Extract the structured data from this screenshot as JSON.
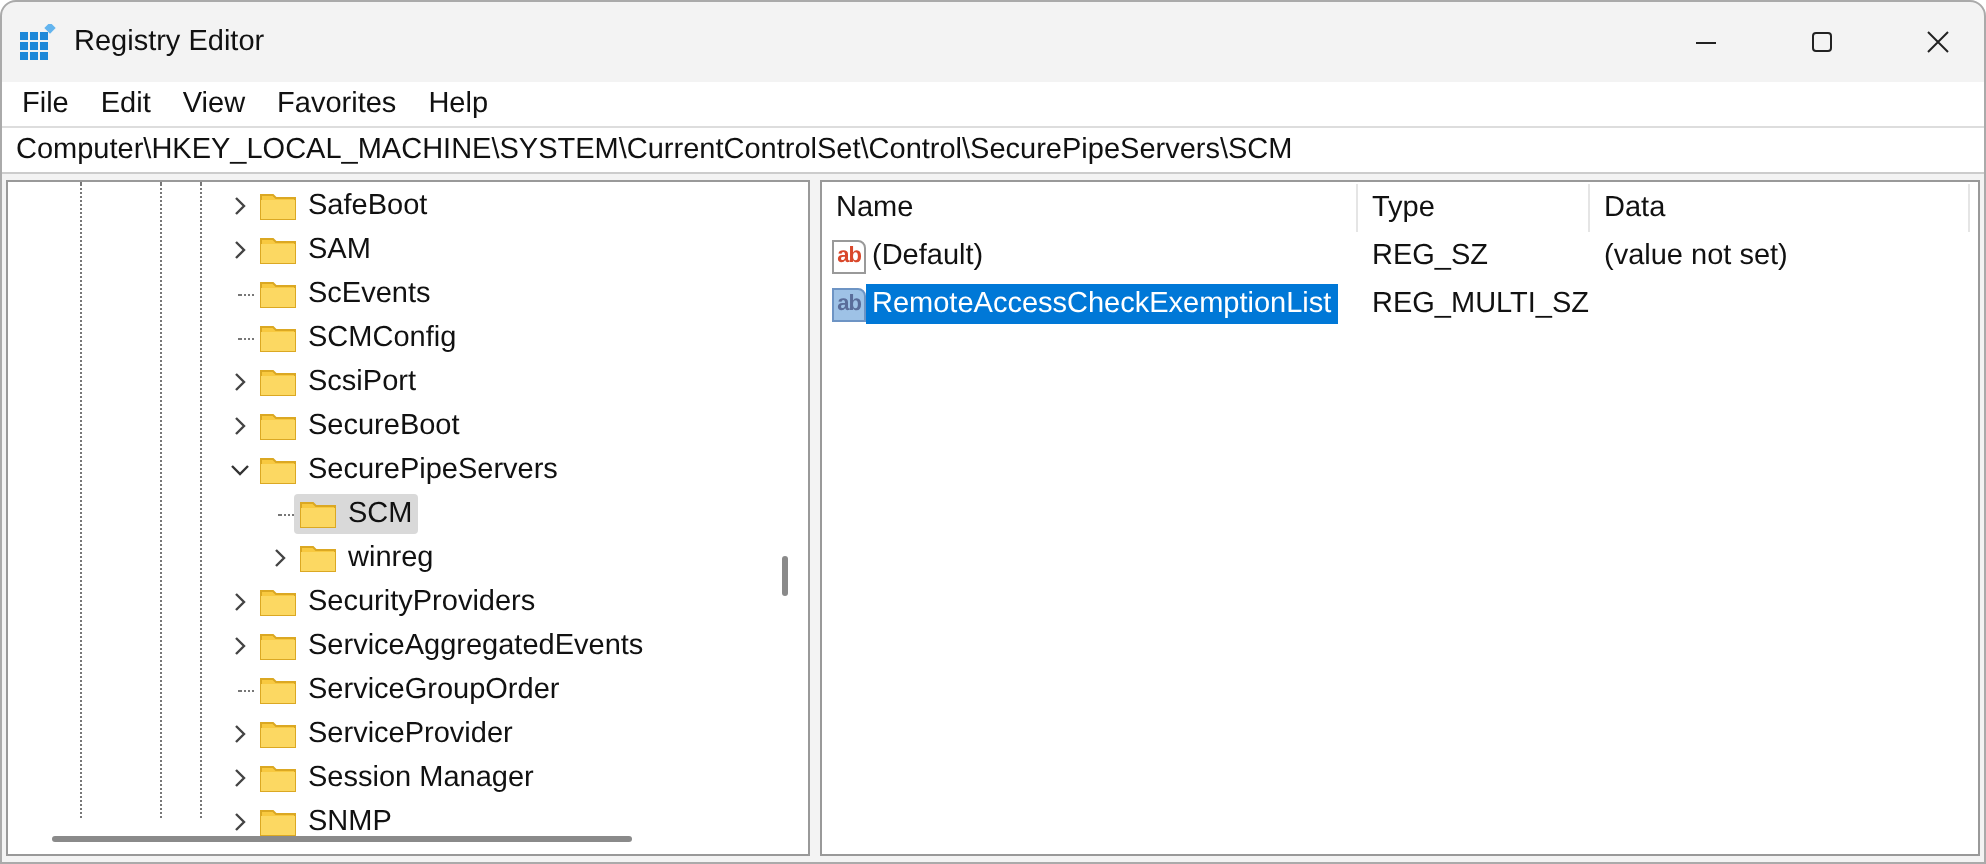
{
  "window": {
    "title": "Registry Editor"
  },
  "menu": [
    {
      "label": "File"
    },
    {
      "label": "Edit"
    },
    {
      "label": "View"
    },
    {
      "label": "Favorites"
    },
    {
      "label": "Help"
    }
  ],
  "address": {
    "value": "Computer\\HKEY_LOCAL_MACHINE\\SYSTEM\\CurrentControlSet\\Control\\SecurePipeServers\\SCM"
  },
  "tree": {
    "items": [
      {
        "label": "SafeBoot",
        "kind": "branch",
        "expanded": false,
        "selected": false
      },
      {
        "label": "SAM",
        "kind": "branch",
        "expanded": false,
        "selected": false
      },
      {
        "label": "ScEvents",
        "kind": "leaf",
        "selected": false
      },
      {
        "label": "SCMConfig",
        "kind": "leaf",
        "selected": false
      },
      {
        "label": "ScsiPort",
        "kind": "branch",
        "expanded": false,
        "selected": false
      },
      {
        "label": "SecureBoot",
        "kind": "branch",
        "expanded": false,
        "selected": false
      },
      {
        "label": "SecurePipeServers",
        "kind": "branch",
        "expanded": true,
        "selected": false,
        "children": [
          {
            "label": "SCM",
            "kind": "leaf",
            "selected": true
          },
          {
            "label": "winreg",
            "kind": "branch",
            "expanded": false,
            "selected": false
          }
        ]
      },
      {
        "label": "SecurityProviders",
        "kind": "branch",
        "expanded": false,
        "selected": false
      },
      {
        "label": "ServiceAggregatedEvents",
        "kind": "branch",
        "expanded": false,
        "selected": false
      },
      {
        "label": "ServiceGroupOrder",
        "kind": "leaf",
        "selected": false
      },
      {
        "label": "ServiceProvider",
        "kind": "branch",
        "expanded": false,
        "selected": false
      },
      {
        "label": "Session Manager",
        "kind": "branch",
        "expanded": false,
        "selected": false
      },
      {
        "label": "SNMP",
        "kind": "branch",
        "expanded": false,
        "selected": false
      }
    ]
  },
  "values": {
    "columns": [
      "Name",
      "Type",
      "Data"
    ],
    "rows": [
      {
        "icon": "ab",
        "name": "(Default)",
        "type": "REG_SZ",
        "data": "(value not set)",
        "selected": false
      },
      {
        "icon": "ab",
        "name": "RemoteAccessCheckExemptionList",
        "type": "REG_MULTI_SZ",
        "selected": true
      }
    ]
  }
}
